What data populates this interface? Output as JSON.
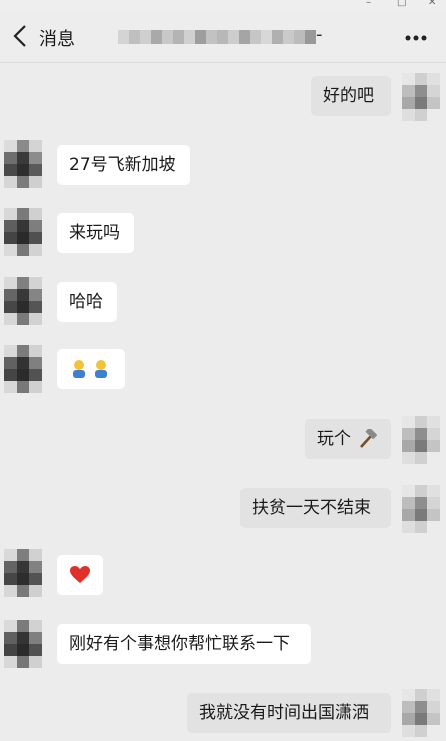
{
  "header": {
    "back_label": "消息",
    "title_suffix": "-"
  },
  "messages": [
    {
      "side": "right",
      "text": "好的吧"
    },
    {
      "side": "left",
      "text": "27号飞新加坡"
    },
    {
      "side": "left",
      "text": "来玩吗"
    },
    {
      "side": "left",
      "text": "哈哈"
    },
    {
      "side": "left",
      "emoji": "two-people-emoji"
    },
    {
      "side": "right",
      "text": "玩个",
      "emoji": "hammer-emoji"
    },
    {
      "side": "right",
      "text": "扶贫一天不结束"
    },
    {
      "side": "left",
      "emoji": "heart-emoji"
    },
    {
      "side": "left",
      "text": "刚好有个事想你帮忙联系一下"
    },
    {
      "side": "right",
      "text": "我就没有时间出国潇洒"
    }
  ],
  "colors": {
    "background": "#ececec",
    "left_bubble": "#ffffff",
    "right_bubble": "#e2e2e2",
    "heart": "#e0302a"
  }
}
